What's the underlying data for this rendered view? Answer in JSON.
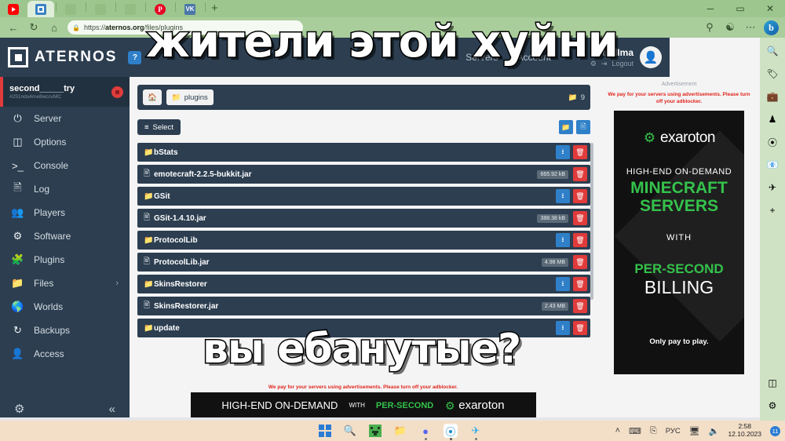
{
  "browser": {
    "tabs": [
      {
        "name": "youtube-tab",
        "icon": "youtube-icon",
        "active": false
      },
      {
        "name": "aternos-tab",
        "icon": "aternos-icon",
        "active": true
      },
      {
        "name": "grey-tab-1",
        "icon": "generic-page-icon",
        "active": false
      },
      {
        "name": "grey-tab-2",
        "icon": "generic-page-icon",
        "active": false
      },
      {
        "name": "grey-tab-3",
        "icon": "generic-page-icon",
        "active": false
      },
      {
        "name": "pinterest-tab",
        "icon": "pinterest-icon",
        "active": false
      },
      {
        "name": "vk-tab",
        "icon": "vk-icon",
        "active": false
      }
    ],
    "new_tab_label": "+",
    "window_controls": {
      "minimize": "─",
      "maximize": "▭",
      "close": "✕"
    },
    "nav": {
      "back": "←",
      "reload": "↻",
      "home": "⌂"
    },
    "url_prefix": "https://",
    "url_domain": "aternos.org",
    "url_path": "/files/plugins",
    "lock_icon": "lock-icon",
    "toolbar_right": [
      "collections-icon",
      "extensions-icon",
      "more-icon"
    ],
    "bing_label": "b",
    "sidebar_icons": [
      "search-icon",
      "shopping-tag-icon",
      "tools-briefcase-icon",
      "games-icon",
      "copilot-icon",
      "outlook-icon",
      "telegram-icon",
      "add-icon",
      "split-screen-icon",
      "settings-gear-icon"
    ]
  },
  "aternos": {
    "brand": "ATERNOS",
    "help_badge": "?",
    "nav_links": [
      "Servers",
      "Account"
    ],
    "user": {
      "name": "lltorlIma",
      "settings_icon": "gear-icon",
      "logout_label": "Logout",
      "logout_icon": "logout-icon",
      "avatar_icon": "avatar-icon"
    },
    "server": {
      "name": "second_____try",
      "id": "#251ndu4me8wccvMC",
      "status_color": "#e03c3c"
    },
    "sidebar_items": [
      {
        "label": "Server",
        "icon": "power-icon"
      },
      {
        "label": "Options",
        "icon": "sliders-icon"
      },
      {
        "label": "Console",
        "icon": "terminal-icon"
      },
      {
        "label": "Log",
        "icon": "document-icon"
      },
      {
        "label": "Players",
        "icon": "users-icon"
      },
      {
        "label": "Software",
        "icon": "cogs-icon"
      },
      {
        "label": "Plugins",
        "icon": "puzzle-icon"
      },
      {
        "label": "Files",
        "icon": "folder-icon",
        "chevron": "›"
      },
      {
        "label": "Worlds",
        "icon": "globe-icon"
      },
      {
        "label": "Backups",
        "icon": "history-icon"
      },
      {
        "label": "Access",
        "icon": "user-lock-icon"
      }
    ],
    "sidebar_bottom": {
      "settings_icon": "gear-icon",
      "collapse_icon": "collapse-icon",
      "collapse_glyph": "«"
    }
  },
  "files": {
    "breadcrumb": {
      "home_icon": "home-icon",
      "folder_icon": "folder-icon",
      "current": "plugins"
    },
    "folder_count": "9",
    "folder_count_icon": "folder-icon",
    "select_label": "Select",
    "select_icon": "list-icon",
    "toolbar_buttons": [
      {
        "name": "new-folder-button",
        "icon": "folder-plus-icon"
      },
      {
        "name": "new-file-button",
        "icon": "file-plus-icon"
      }
    ],
    "rows": [
      {
        "name": "bStats",
        "type": "folder",
        "size": "",
        "download": true
      },
      {
        "name": "emotecraft-2.2.5-bukkit.jar",
        "type": "file",
        "size": "665.92 kB",
        "download": false
      },
      {
        "name": "GSit",
        "type": "folder",
        "size": "",
        "download": true
      },
      {
        "name": "GSit-1.4.10.jar",
        "type": "file",
        "size": "388.38 kB",
        "download": false
      },
      {
        "name": "ProtocolLib",
        "type": "folder",
        "size": "",
        "download": true
      },
      {
        "name": "ProtocolLib.jar",
        "type": "file",
        "size": "4.98 MB",
        "download": false
      },
      {
        "name": "SkinsRestorer",
        "type": "folder",
        "size": "",
        "download": true
      },
      {
        "name": "SkinsRestorer.jar",
        "type": "file",
        "size": "2.43 MB",
        "download": false
      },
      {
        "name": "update",
        "type": "folder",
        "size": "",
        "download": true
      }
    ],
    "download_icon": "download-icon",
    "delete_icon": "trash-icon"
  },
  "ad": {
    "label": "Advertisement",
    "warning": "We pay for your servers using advertisements. Please turn off your adblocker.",
    "brand": "exaroton",
    "brand_icon": "gear-icon",
    "line1": "HIGH-END ON-DEMAND",
    "line2": "MINECRAFT",
    "line3": "SERVERS",
    "line4": "WITH",
    "line5": "PER-SECOND",
    "line6": "BILLING",
    "line7": "Only pay to play.",
    "accent_green": "#34c24b",
    "warning_red": "#e1251b"
  },
  "meme": {
    "top_text": "жители этой хуйни",
    "bottom_text": "вы ебанутые?"
  },
  "taskbar": {
    "items": [
      {
        "name": "start-button",
        "icon": "windows-icon"
      },
      {
        "name": "search-button",
        "icon": "search-icon"
      },
      {
        "name": "minecraft-button",
        "icon": "creeper-icon"
      },
      {
        "name": "file-explorer-button",
        "icon": "folder-icon"
      },
      {
        "name": "discord-button",
        "icon": "discord-icon"
      },
      {
        "name": "edge-button",
        "icon": "edge-icon"
      },
      {
        "name": "telegram-button",
        "icon": "telegram-icon"
      }
    ],
    "tray": {
      "chevron": "˄",
      "keyboard_icon": "keyboard-icon",
      "touchpad_icon": "touchpad-icon",
      "language": "РУС",
      "network_icon": "network-icon",
      "volume_icon": "volume-icon",
      "time": "2:58",
      "date": "12.10.2023",
      "badge_count": "11"
    }
  }
}
